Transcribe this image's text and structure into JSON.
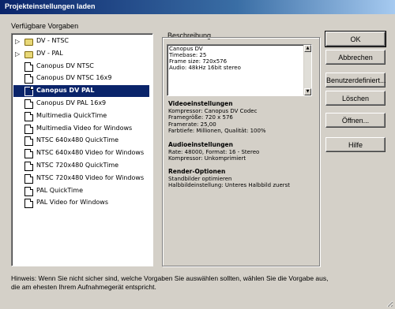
{
  "window": {
    "title": "Projekteinstellungen laden"
  },
  "presets": {
    "label": "Verfügbare Vorgaben",
    "items": [
      {
        "label": "DV - NTSC",
        "type": "folder"
      },
      {
        "label": "DV - PAL",
        "type": "folder"
      },
      {
        "label": "Canopus DV NTSC",
        "type": "doc"
      },
      {
        "label": "Canopus DV NTSC 16x9",
        "type": "doc"
      },
      {
        "label": "Canopus DV PAL",
        "type": "doc",
        "selected": true
      },
      {
        "label": "Canopus DV PAL 16x9",
        "type": "doc"
      },
      {
        "label": "Multimedia QuickTime",
        "type": "doc"
      },
      {
        "label": "Multimedia Video for Windows",
        "type": "doc"
      },
      {
        "label": "NTSC 640x480 QuickTime",
        "type": "doc"
      },
      {
        "label": "NTSC 640x480 Video for Windows",
        "type": "doc"
      },
      {
        "label": "NTSC 720x480 QuickTime",
        "type": "doc"
      },
      {
        "label": "NTSC 720x480 Video for Windows",
        "type": "doc"
      },
      {
        "label": "PAL QuickTime",
        "type": "doc"
      },
      {
        "label": "PAL Video for Windows",
        "type": "doc"
      }
    ]
  },
  "description": {
    "label": "Beschreibung",
    "lines": [
      "Canopus DV",
      "Timebase: 25",
      "Frame size: 720x576",
      "Audio: 48kHz 16bit stereo"
    ]
  },
  "video": {
    "heading": "Videoeinstellungen",
    "lines": [
      "Kompressor: Canopus DV Codec",
      "Framegröße: 720 x 576",
      "Framerate: 25,00",
      "Farbtiefe: Millionen, Qualität: 100%"
    ]
  },
  "audio": {
    "heading": "Audioeinstellungen",
    "lines": [
      "Rate: 48000, Format: 16 - Stereo",
      "Kompressor: Unkomprimiert"
    ]
  },
  "render": {
    "heading": "Render-Optionen",
    "lines": [
      "Standbilder optimieren",
      "Halbbildeinstellung: Unteres Halbbild zuerst"
    ]
  },
  "buttons": {
    "ok": "OK",
    "cancel": "Abbrechen",
    "custom": "Benutzerdefiniert...",
    "delete": "Löschen",
    "open": "Öffnen...",
    "help": "Hilfe"
  },
  "hint": {
    "line1": "Hinweis: Wenn Sie nicht sicher sind, welche Vorgaben Sie auswählen sollten, wählen Sie die Vorgabe aus,",
    "line2": "die am ehesten Ihrem Aufnahmegerät entspricht."
  },
  "colors": {
    "selection": "#0a246a",
    "titlebar": "#0a246a",
    "face": "#d4d0c8"
  }
}
